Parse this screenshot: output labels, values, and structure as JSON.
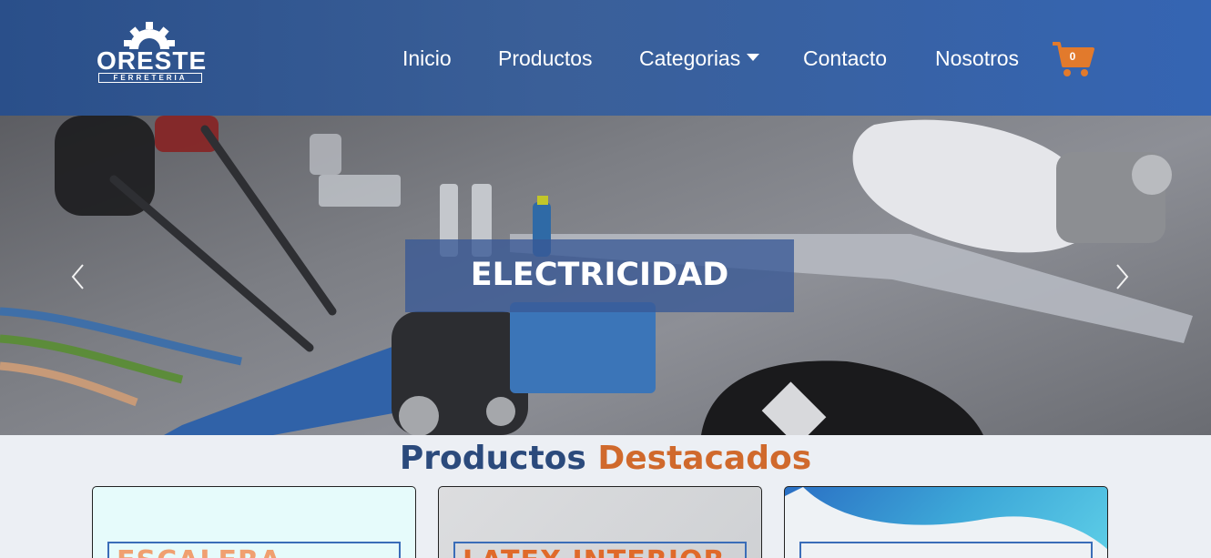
{
  "brand": {
    "name": "ORESTE",
    "subtitle": "FERRETERIA"
  },
  "nav": {
    "items": [
      {
        "label": "Inicio"
      },
      {
        "label": "Productos"
      },
      {
        "label": "Categorias"
      },
      {
        "label": "Contacto"
      },
      {
        "label": "Nosotros"
      }
    ],
    "cart_count": "0"
  },
  "hero": {
    "caption": "ELECTRICIDAD",
    "prev_icon": "chevron-left-icon",
    "next_icon": "chevron-right-icon"
  },
  "featured": {
    "title_part1": "Productos",
    "title_part2": "Destacados",
    "cards": [
      {
        "image_text": "ESCALERA"
      },
      {
        "image_text": "LATEX INTERIOR"
      },
      {
        "image_text": ""
      }
    ]
  },
  "colors": {
    "navbar": "#2f5a9a",
    "accent_orange": "#d0692c",
    "title_blue": "#2b4a7c",
    "cart_orange": "#e27a2c"
  }
}
